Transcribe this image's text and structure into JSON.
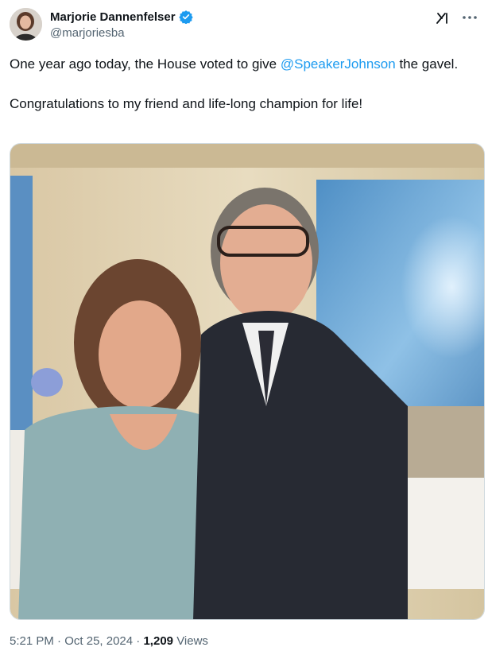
{
  "author": {
    "display_name": "Marjorie Dannenfelser",
    "handle": "@marjoriesba",
    "verified": true
  },
  "icons": {
    "verified": "verified-badge-icon",
    "grok": "grok-icon",
    "more": "more-options-icon"
  },
  "tweet": {
    "line1_before": "One year ago today, the House voted to give ",
    "mention": "@SpeakerJohnson",
    "line1_after": " the gavel.",
    "line2": "Congratulations to my friend and life-long champion for life!"
  },
  "meta": {
    "time": "5:21 PM",
    "date": "Oct 25, 2024",
    "separator": "·",
    "views_count": "1,209",
    "views_label": "Views"
  },
  "colors": {
    "link": "#1d9bf0",
    "secondary_text": "#536471",
    "primary_text": "#0f1419",
    "verified_blue": "#1d9bf0"
  }
}
